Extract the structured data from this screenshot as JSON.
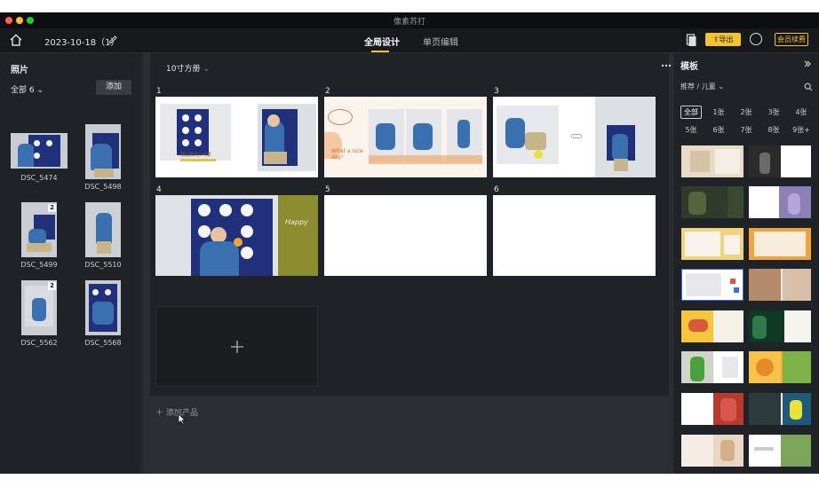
{
  "window": {
    "app_title": "像素苏打"
  },
  "topbar": {
    "doc_title": "2023-10-18（1）",
    "tabs": [
      {
        "label": "全局设计",
        "active": true
      },
      {
        "label": "单页编辑",
        "active": false
      }
    ],
    "export_label": "导出",
    "member_label": "会员续费"
  },
  "photos_panel": {
    "title": "照片",
    "filter_label": "全部 6",
    "add_label": "添加",
    "photos": [
      {
        "name": "DSC_5474",
        "badge": ""
      },
      {
        "name": "DSC_5498",
        "badge": ""
      },
      {
        "name": "DSC_5499",
        "badge": "2"
      },
      {
        "name": "DSC_5510",
        "badge": ""
      },
      {
        "name": "DSC_5562",
        "badge": "2"
      },
      {
        "name": "DSC_5568",
        "badge": ""
      }
    ]
  },
  "editor": {
    "product_name": "10寸方册",
    "pages": [
      {
        "num": "1",
        "caption": "我是真的小可爱"
      },
      {
        "num": "2",
        "caption": "What a nice day!"
      },
      {
        "num": "3",
        "caption": ""
      },
      {
        "num": "4",
        "caption": "Happy"
      },
      {
        "num": "5",
        "caption": ""
      },
      {
        "num": "6",
        "caption": ""
      }
    ],
    "add_product_label": "添加产品"
  },
  "templates_panel": {
    "title": "模板",
    "category": "推荐 / 儿童",
    "count_filters": [
      {
        "label": "全部",
        "active": true
      },
      {
        "label": "1张"
      },
      {
        "label": "2张"
      },
      {
        "label": "3张"
      },
      {
        "label": "4张"
      },
      {
        "label": "5张"
      },
      {
        "label": "6张"
      },
      {
        "label": "7张"
      },
      {
        "label": "8张"
      },
      {
        "label": "9张+"
      }
    ]
  },
  "colors": {
    "accent": "#f2c230",
    "panel": "#1f2226",
    "topbar": "#16181b"
  }
}
